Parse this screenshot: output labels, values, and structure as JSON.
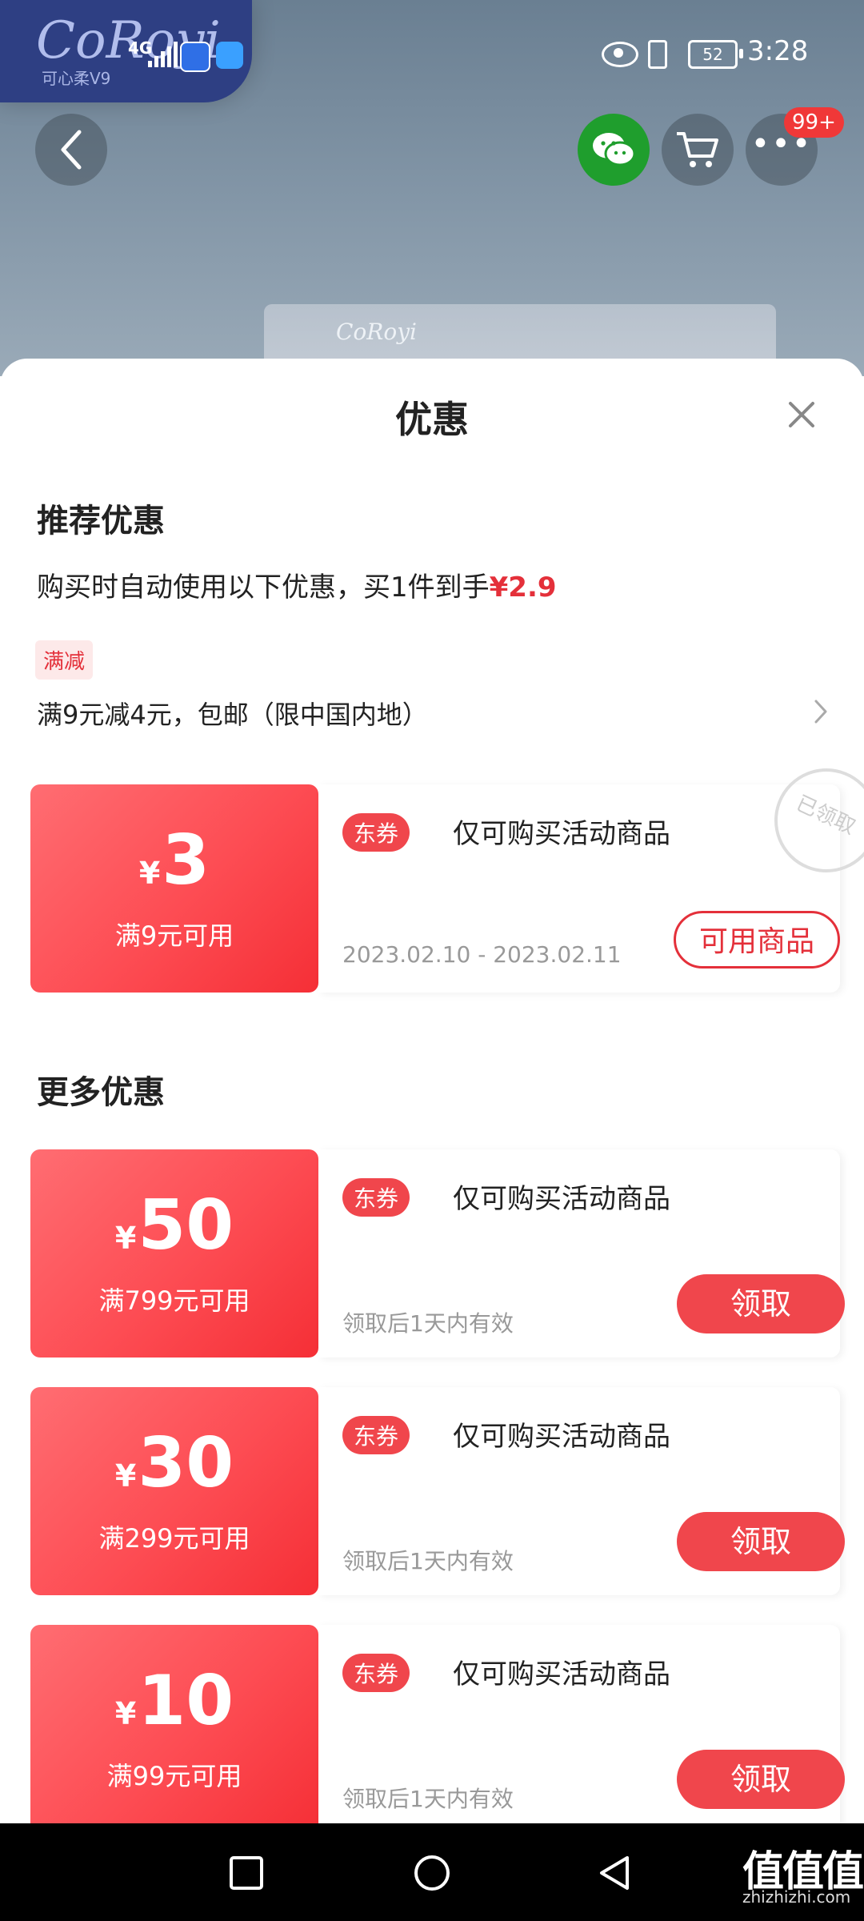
{
  "status_bar": {
    "network": "4G",
    "battery": "52",
    "time": "3:28"
  },
  "background": {
    "logo_text": "CoRoyi",
    "logo_sub": "可心柔V9",
    "package_label": "CoRoyi"
  },
  "top_actions": {
    "badge": "99+",
    "more": "•••"
  },
  "sheet": {
    "title": "优惠",
    "recommended": {
      "title": "推荐优惠",
      "desc_prefix": "购买时自动使用以下优惠，买1件到手",
      "price": "¥2.9",
      "tag": "满减",
      "promo": "满9元减4元，包邮（限中国内地）"
    },
    "more_title": "更多优惠",
    "coupons": [
      {
        "yen": "¥",
        "amount": "3",
        "condition": "满9元可用",
        "tag": "东券",
        "desc": "仅可购买活动商品",
        "validity": "2023.02.10 - 2023.02.11",
        "button": "可用商品",
        "stamp": "已领取"
      },
      {
        "yen": "¥",
        "amount": "50",
        "condition": "满799元可用",
        "tag": "东券",
        "desc": "仅可购买活动商品",
        "validity": "领取后1天内有效",
        "button": "领取"
      },
      {
        "yen": "¥",
        "amount": "30",
        "condition": "满299元可用",
        "tag": "东券",
        "desc": "仅可购买活动商品",
        "validity": "领取后1天内有效",
        "button": "领取"
      },
      {
        "yen": "¥",
        "amount": "10",
        "condition": "满99元可用",
        "tag": "东券",
        "desc": "仅可购买活动商品",
        "validity": "领取后1天内有效",
        "button": "领取"
      }
    ]
  },
  "watermark": {
    "text": "值值值",
    "sub": "zhizhizhi.com"
  },
  "colors": {
    "accent": "#e4303a",
    "coupon_red": "#f52f36",
    "wechat_green": "#1f9e2d"
  }
}
